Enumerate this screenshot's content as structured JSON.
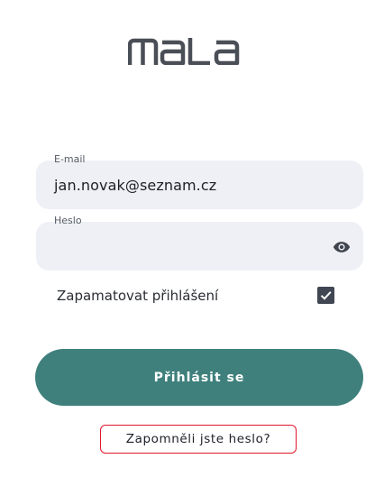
{
  "app": {
    "brand": "mala"
  },
  "login_form": {
    "email": {
      "label": "E-mail",
      "value": "jan.novak@seznam.cz"
    },
    "password": {
      "label": "Heslo",
      "value": "",
      "toggle_icon": "eye-icon"
    },
    "remember": {
      "label": "Zapamatovat přihlášení",
      "checked": true
    },
    "submit_label": "Přihlásit se",
    "forgot_label": "Zapomněli jste heslo?"
  },
  "colors": {
    "primary": "#3f807d",
    "field_bg": "#eef0f6",
    "checkbox": "#404652",
    "logo": "#4a4e56",
    "highlight_border": "#e0162b"
  }
}
